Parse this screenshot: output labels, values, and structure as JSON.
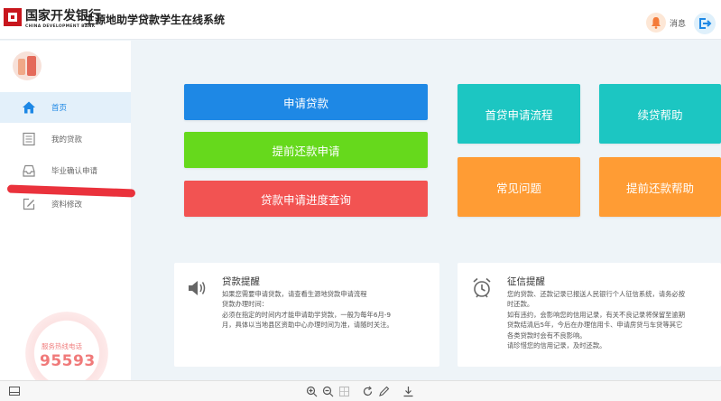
{
  "header": {
    "bank_name_cn": "国家开发银行",
    "bank_name_en": "CHINA DEVELOPMENT BANK",
    "system_title": "生源地助学贷款学生在线系统",
    "message_label": "消息"
  },
  "sidebar": {
    "items": [
      {
        "label": "首页",
        "icon": "home-icon",
        "active": true
      },
      {
        "label": "我的贷款",
        "icon": "document-list-icon",
        "active": false
      },
      {
        "label": "毕业确认申请",
        "icon": "inbox-icon",
        "active": false
      },
      {
        "label": "资料修改",
        "icon": "edit-icon",
        "active": false
      }
    ],
    "hotline_label": "服务热线电话",
    "hotline_number": "95593"
  },
  "tiles": {
    "apply_loan": "申请贷款",
    "early_repay_apply": "提前还款申请",
    "loan_progress": "贷款申请进度查询",
    "first_loan_process": "首贷申请流程",
    "renew_help": "续贷帮助",
    "faq": "常见问题",
    "early_repay_help": "提前还款帮助"
  },
  "notices": {
    "loan_reminder": {
      "title": "贷款提醒",
      "lines": [
        "如果您需要申请贷款，请查看生源地贷款申请流程",
        "贷款办理时间：",
        "必须在指定的时间内才能申请助学贷款，一般为每年6月-9",
        "月，具体以当地县区资助中心办理时间为准，请随时关注。"
      ]
    },
    "credit_reminder": {
      "title": "征信提醒",
      "lines": [
        "您的贷款、还款记录已报送人民银行个人征信系统，请务必按",
        "时还款。",
        "如有违约，会影响您的信用记录，有关不良记录将保留至逾期",
        "贷款结清后5年，今后在办理信用卡、申请房贷与车贷等其它",
        "各类贷款时会有不良影响。",
        "请珍惜您的信用记录，及时还款。"
      ]
    }
  },
  "colors": {
    "blue": "#1e88e5",
    "green": "#66d91c",
    "red": "#f25352",
    "teal": "#1cc6c2",
    "orange": "#ff9c34"
  }
}
